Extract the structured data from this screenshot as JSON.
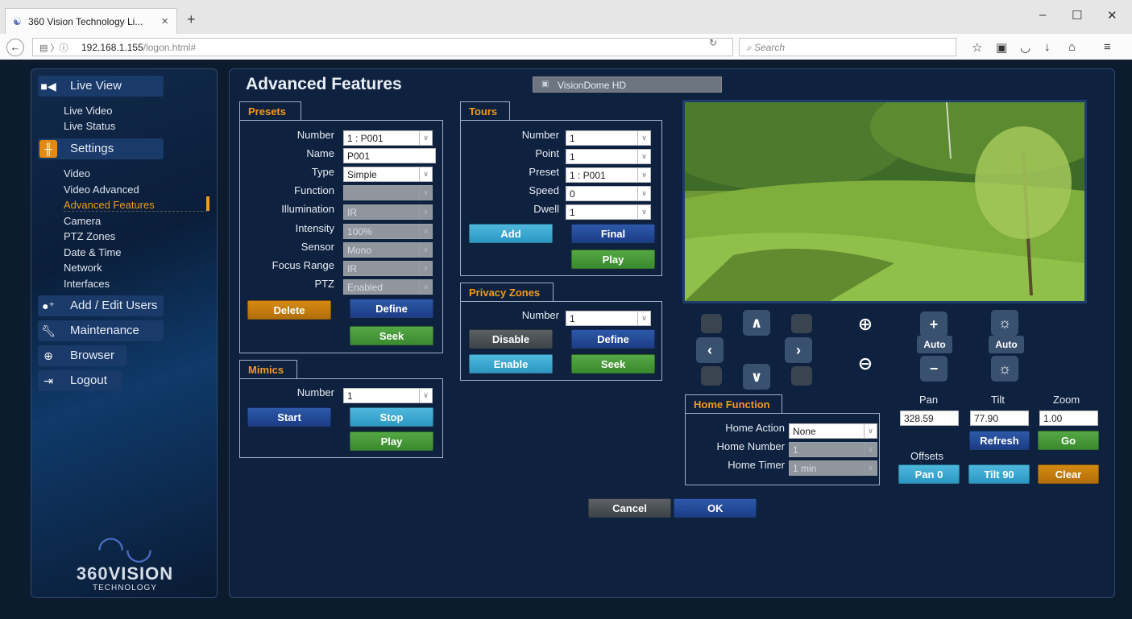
{
  "browser": {
    "tab_title": "360 Vision Technology Li...",
    "url_host": "192.168.1.155",
    "url_path": "/logon.html#",
    "search_placeholder": "Search"
  },
  "sidebar": {
    "live_view": "Live View",
    "live_video": "Live Video",
    "live_status": "Live Status",
    "settings": "Settings",
    "video": "Video",
    "video_advanced": "Video Advanced",
    "advanced_features": "Advanced Features",
    "camera": "Camera",
    "ptz_zones": "PTZ Zones",
    "date_time": "Date & Time",
    "network": "Network",
    "interfaces": "Interfaces",
    "add_edit_users": "Add / Edit Users",
    "maintenance": "Maintenance",
    "browser": "Browser",
    "logout": "Logout",
    "logo_brand_bold": "360",
    "logo_brand": "VISION",
    "logo_sub": "TECHNOLOGY"
  },
  "main": {
    "title": "Advanced Features",
    "camera_name": "VisionDome HD"
  },
  "presets": {
    "tab": "Presets",
    "number_label": "Number",
    "number_value": "1 : P001",
    "name_label": "Name",
    "name_value": "P001",
    "type_label": "Type",
    "type_value": "Simple",
    "function_label": "Function",
    "function_value": "",
    "illumination_label": "Illumination",
    "illumination_value": "IR",
    "intensity_label": "Intensity",
    "intensity_value": "100%",
    "sensor_label": "Sensor",
    "sensor_value": "Mono",
    "focus_label": "Focus Range",
    "focus_value": "IR",
    "ptz_label": "PTZ",
    "ptz_value": "Enabled",
    "delete": "Delete",
    "define": "Define",
    "seek": "Seek"
  },
  "mimics": {
    "tab": "Mimics",
    "number_label": "Number",
    "number_value": "1",
    "start": "Start",
    "stop": "Stop",
    "play": "Play"
  },
  "tours": {
    "tab": "Tours",
    "number_label": "Number",
    "number_value": "1",
    "point_label": "Point",
    "point_value": "1",
    "preset_label": "Preset",
    "preset_value": "1 : P001",
    "speed_label": "Speed",
    "speed_value": "0",
    "dwell_label": "Dwell",
    "dwell_value": "1",
    "add": "Add",
    "final": "Final",
    "play": "Play"
  },
  "privacy": {
    "tab": "Privacy Zones",
    "number_label": "Number",
    "number_value": "1",
    "disable": "Disable",
    "define": "Define",
    "enable": "Enable",
    "seek": "Seek"
  },
  "controls": {
    "auto_focus": "Auto",
    "auto_iris": "Auto",
    "pan_label": "Pan",
    "tilt_label": "Tilt",
    "zoom_label": "Zoom",
    "pan_value": "328.59",
    "tilt_value": "77.90",
    "zoom_value": "1.00",
    "refresh": "Refresh",
    "go": "Go",
    "offsets_label": "Offsets",
    "pan0": "Pan 0",
    "tilt90": "Tilt 90",
    "clear": "Clear"
  },
  "home": {
    "tab": "Home Function",
    "action_label": "Home Action",
    "action_value": "None",
    "number_label": "Home Number",
    "number_value": "1",
    "timer_label": "Home Timer",
    "timer_value": "1 min"
  },
  "footer": {
    "cancel": "Cancel",
    "ok": "OK"
  },
  "colors": {
    "accent_orange": "#f39a1a",
    "button_blue": "#1c3c86",
    "button_green": "#3a8a2f",
    "button_cyan": "#2b98c3"
  }
}
